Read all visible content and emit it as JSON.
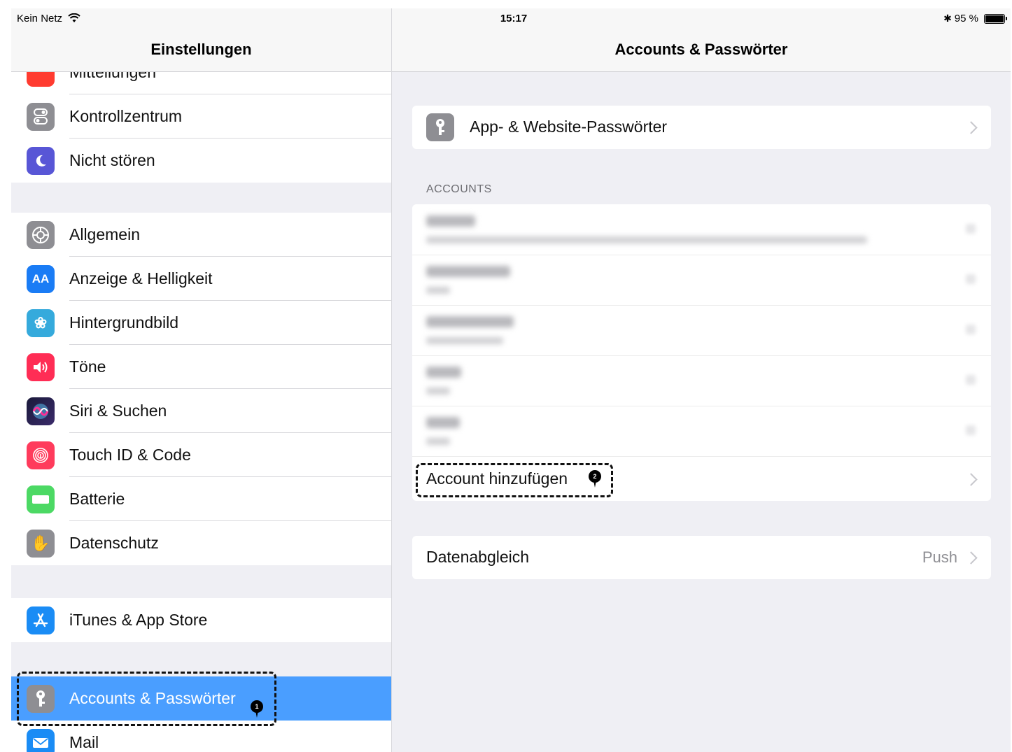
{
  "status_bar": {
    "carrier": "Kein Netz",
    "time": "15:17",
    "battery": "95 %"
  },
  "sidebar": {
    "title": "Einstellungen",
    "cut_item": "Mitteilungen",
    "groups": [
      [
        {
          "label": "Kontrollzentrum",
          "icon": "control-center-icon",
          "color": "#8e8e93"
        },
        {
          "label": "Nicht stören",
          "icon": "moon-icon",
          "color": "#5856d6"
        }
      ],
      [
        {
          "label": "Allgemein",
          "icon": "gear-icon",
          "color": "#8e8e93"
        },
        {
          "label": "Anzeige & Helligkeit",
          "icon": "display-icon",
          "color": "#1a7cf5"
        },
        {
          "label": "Hintergrundbild",
          "icon": "wallpaper-icon",
          "color": "#35aadc"
        },
        {
          "label": "Töne",
          "icon": "speaker-icon",
          "color": "#ff2d55"
        },
        {
          "label": "Siri & Suchen",
          "icon": "siri-icon",
          "color": "#222244"
        },
        {
          "label": "Touch ID & Code",
          "icon": "fingerprint-icon",
          "color": "#ff3b5c"
        },
        {
          "label": "Batterie",
          "icon": "battery-icon",
          "color": "#4cd964"
        },
        {
          "label": "Datenschutz",
          "icon": "hand-icon",
          "color": "#8e8e93"
        }
      ],
      [
        {
          "label": "iTunes & App Store",
          "icon": "app-store-icon",
          "color": "#1a8cf5"
        }
      ],
      [
        {
          "label": "Accounts & Passwörter",
          "icon": "key-icon",
          "color": "#8e8e93",
          "selected": true
        },
        {
          "label": "Mail",
          "icon": "mail-icon",
          "color": "#1a8cf5"
        }
      ]
    ],
    "callout_number": "1"
  },
  "main": {
    "title": "Accounts & Passwörter",
    "passwords_label": "App- & Website-Passwörter",
    "section_label": "ACCOUNTS",
    "add_account_label": "Account hinzufügen",
    "callout_number": "2",
    "sync_label": "Datenabgleich",
    "sync_value": "Push"
  }
}
